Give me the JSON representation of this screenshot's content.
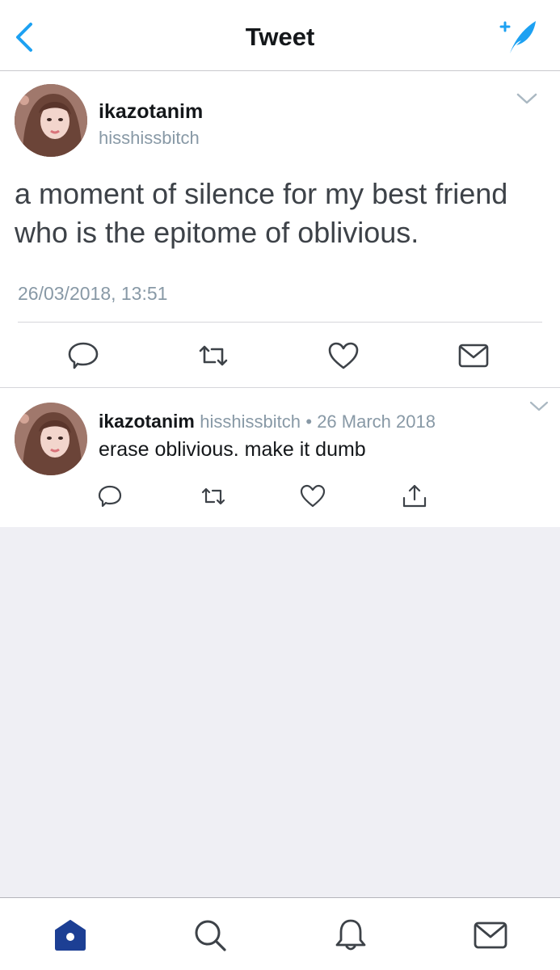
{
  "header": {
    "title": "Tweet",
    "back_icon": "chevron-left-icon",
    "compose_icon": "compose-feather-icon",
    "accent_color": "#1da1f2"
  },
  "main_tweet": {
    "display_name": "ikazotanim",
    "handle": "hisshissbitch",
    "text": "a moment of silence for my best friend who is the epitome of oblivious.",
    "timestamp": "26/03/2018, 13:51",
    "actions": [
      "reply-icon",
      "retweet-icon",
      "like-icon",
      "message-icon"
    ]
  },
  "reply": {
    "display_name": "ikazotanim",
    "handle": "hisshissbitch",
    "date": "• 26 March 2018",
    "text": "erase oblivious. make it dumb",
    "actions": [
      "reply-icon",
      "retweet-icon",
      "like-icon",
      "share-icon"
    ]
  },
  "tabbar": {
    "items": [
      "home-icon",
      "search-icon",
      "notifications-icon",
      "messages-icon"
    ],
    "active": "home",
    "active_color": "#1c3f94"
  }
}
